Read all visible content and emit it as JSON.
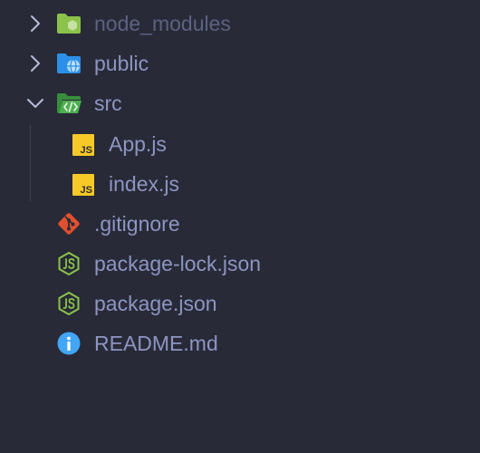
{
  "explorer": {
    "items": [
      {
        "label": "node_modules",
        "kind": "folder",
        "expanded": false,
        "icon": "folder-node-icon"
      },
      {
        "label": "public",
        "kind": "folder",
        "expanded": false,
        "icon": "folder-public-icon"
      },
      {
        "label": "src",
        "kind": "folder",
        "expanded": true,
        "icon": "folder-src-open-icon"
      },
      {
        "label": "App.js",
        "kind": "file",
        "icon": "javascript-file-icon"
      },
      {
        "label": "index.js",
        "kind": "file",
        "icon": "javascript-file-icon"
      },
      {
        "label": ".gitignore",
        "kind": "file",
        "icon": "git-icon"
      },
      {
        "label": "package-lock.json",
        "kind": "file",
        "icon": "nodejs-icon"
      },
      {
        "label": "package.json",
        "kind": "file",
        "icon": "nodejs-icon"
      },
      {
        "label": "README.md",
        "kind": "file",
        "icon": "info-icon"
      }
    ],
    "js_badge": "JS"
  },
  "colors": {
    "background": "#282a37",
    "text": "#8d95c2",
    "chevron": "#b6bcd8",
    "node_folder": "#8bc34a",
    "public_folder": "#2d90e8",
    "src_folder": "#4caf50",
    "js_badge": "#f6c928",
    "git": "#e0502f",
    "nodejs": "#8bc34a",
    "info": "#42a5f5"
  }
}
